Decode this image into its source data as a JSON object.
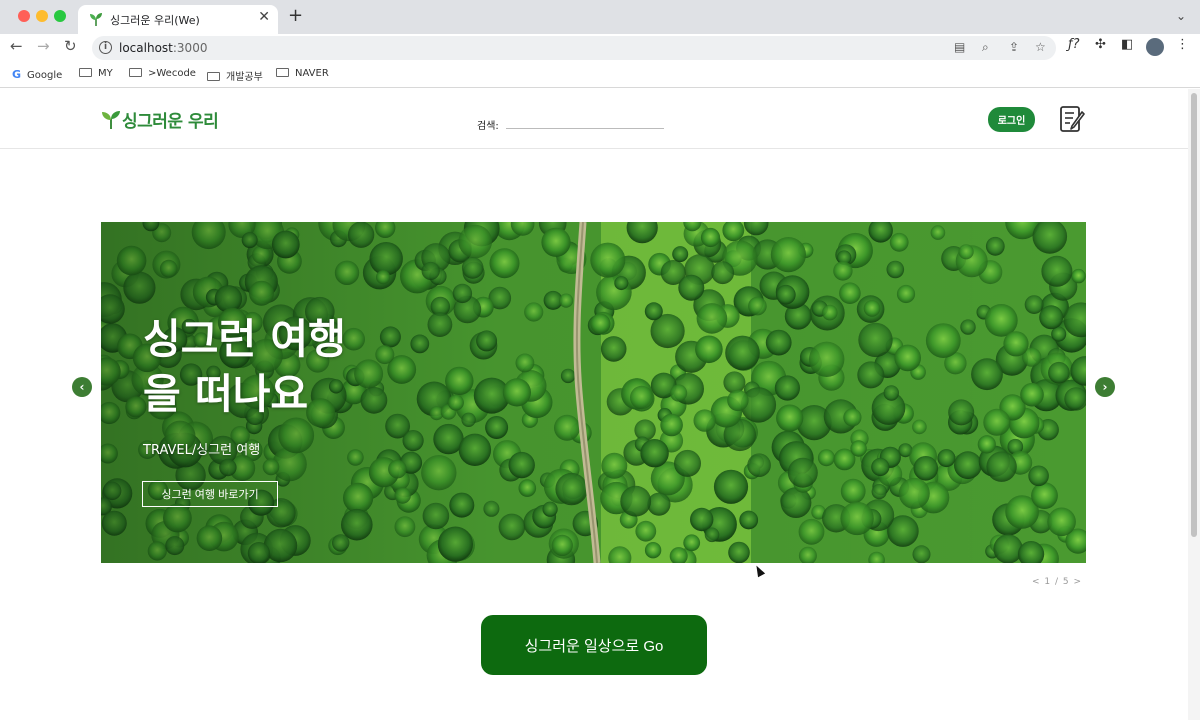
{
  "browser": {
    "tab_title": "싱그러운 우리(We)",
    "tab_close": "✕",
    "new_tab": "+",
    "url_host": "localhost",
    "url_port": ":3000",
    "bookmarks": [
      {
        "label": "Google",
        "type": "site"
      },
      {
        "label": "MY",
        "type": "folder"
      },
      {
        "label": ">Wecode",
        "type": "folder"
      },
      {
        "label": "개발공부",
        "type": "folder"
      },
      {
        "label": "NAVER",
        "type": "folder"
      }
    ]
  },
  "header": {
    "logo_text": "싱그러운 우리",
    "search_label": "검색:",
    "search_value": "",
    "login_label": "로그인",
    "write_icon": "write-icon"
  },
  "hero": {
    "title_line1": "싱그런 여행",
    "title_line2": "을 떠나요",
    "subtitle": "TRAVEL/싱그런 여행",
    "cta_label": "싱그런 여행 바로가기",
    "pager": "< 1 / 5 >",
    "prev_icon": "chevron-left-icon",
    "next_icon": "chevron-right-icon"
  },
  "main": {
    "go_button_label": "싱그러운 일상으로 Go"
  },
  "colors": {
    "brand_green": "#2e8b3a",
    "login_green": "#1f8a3a",
    "go_button_green": "#0d6a0f"
  }
}
